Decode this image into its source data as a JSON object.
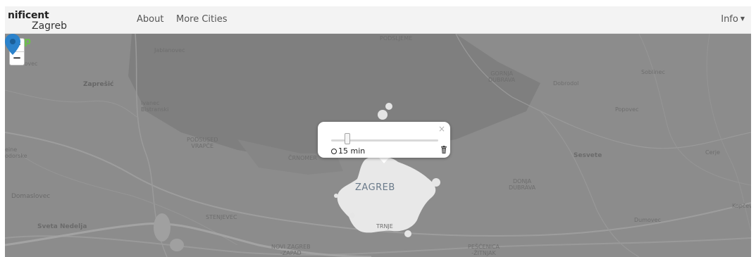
{
  "brand": {
    "map": "Map",
    "rest": "nificent",
    "city": "Zagreb"
  },
  "nav": {
    "about": "About",
    "more_cities": "More Cities",
    "info": "Info"
  },
  "zoom": {
    "in": "+",
    "out": "−"
  },
  "popup": {
    "time": "15 min",
    "close": "×",
    "slider_fraction": 0.15
  },
  "map_labels": {
    "podsljeme": "PODSLJEME",
    "jablanovec": "Jablanovec",
    "zapresic": "Zaprešić",
    "ivanec_bistranski": "Ivanec\nBistranski",
    "podsused_vrapce": "PODSUSED\nVRAPČE",
    "crnomerec": "ČRNOMER",
    "gornja_dubrava": "GORNJA\nDUBRAVA",
    "dobrodol": "Dobrodol",
    "soblinec": "Soblinec",
    "popovec": "Popovec",
    "sesvete": "Sesvete",
    "cerje": "Cerje",
    "donja_dubrava": "DONJA\nDUBRAVA",
    "zagreb": "ZAGREB",
    "trnje": "TRNJE",
    "stenjevec": "STENJEVEC",
    "domaslovec": "Domaslovec",
    "sveta_nedelja": "Sveta Nedelja",
    "novi_zagreb": "NOVI ZAGREB\n-ZAPAD",
    "pescenica": "PEŠĆENICA\n-ŽITNJAK",
    "dumovec": "Dumovec",
    "kopcevec": "Kopčev",
    "ilovec": "ilovec",
    "seine_odorske": "eine\nodorske"
  }
}
